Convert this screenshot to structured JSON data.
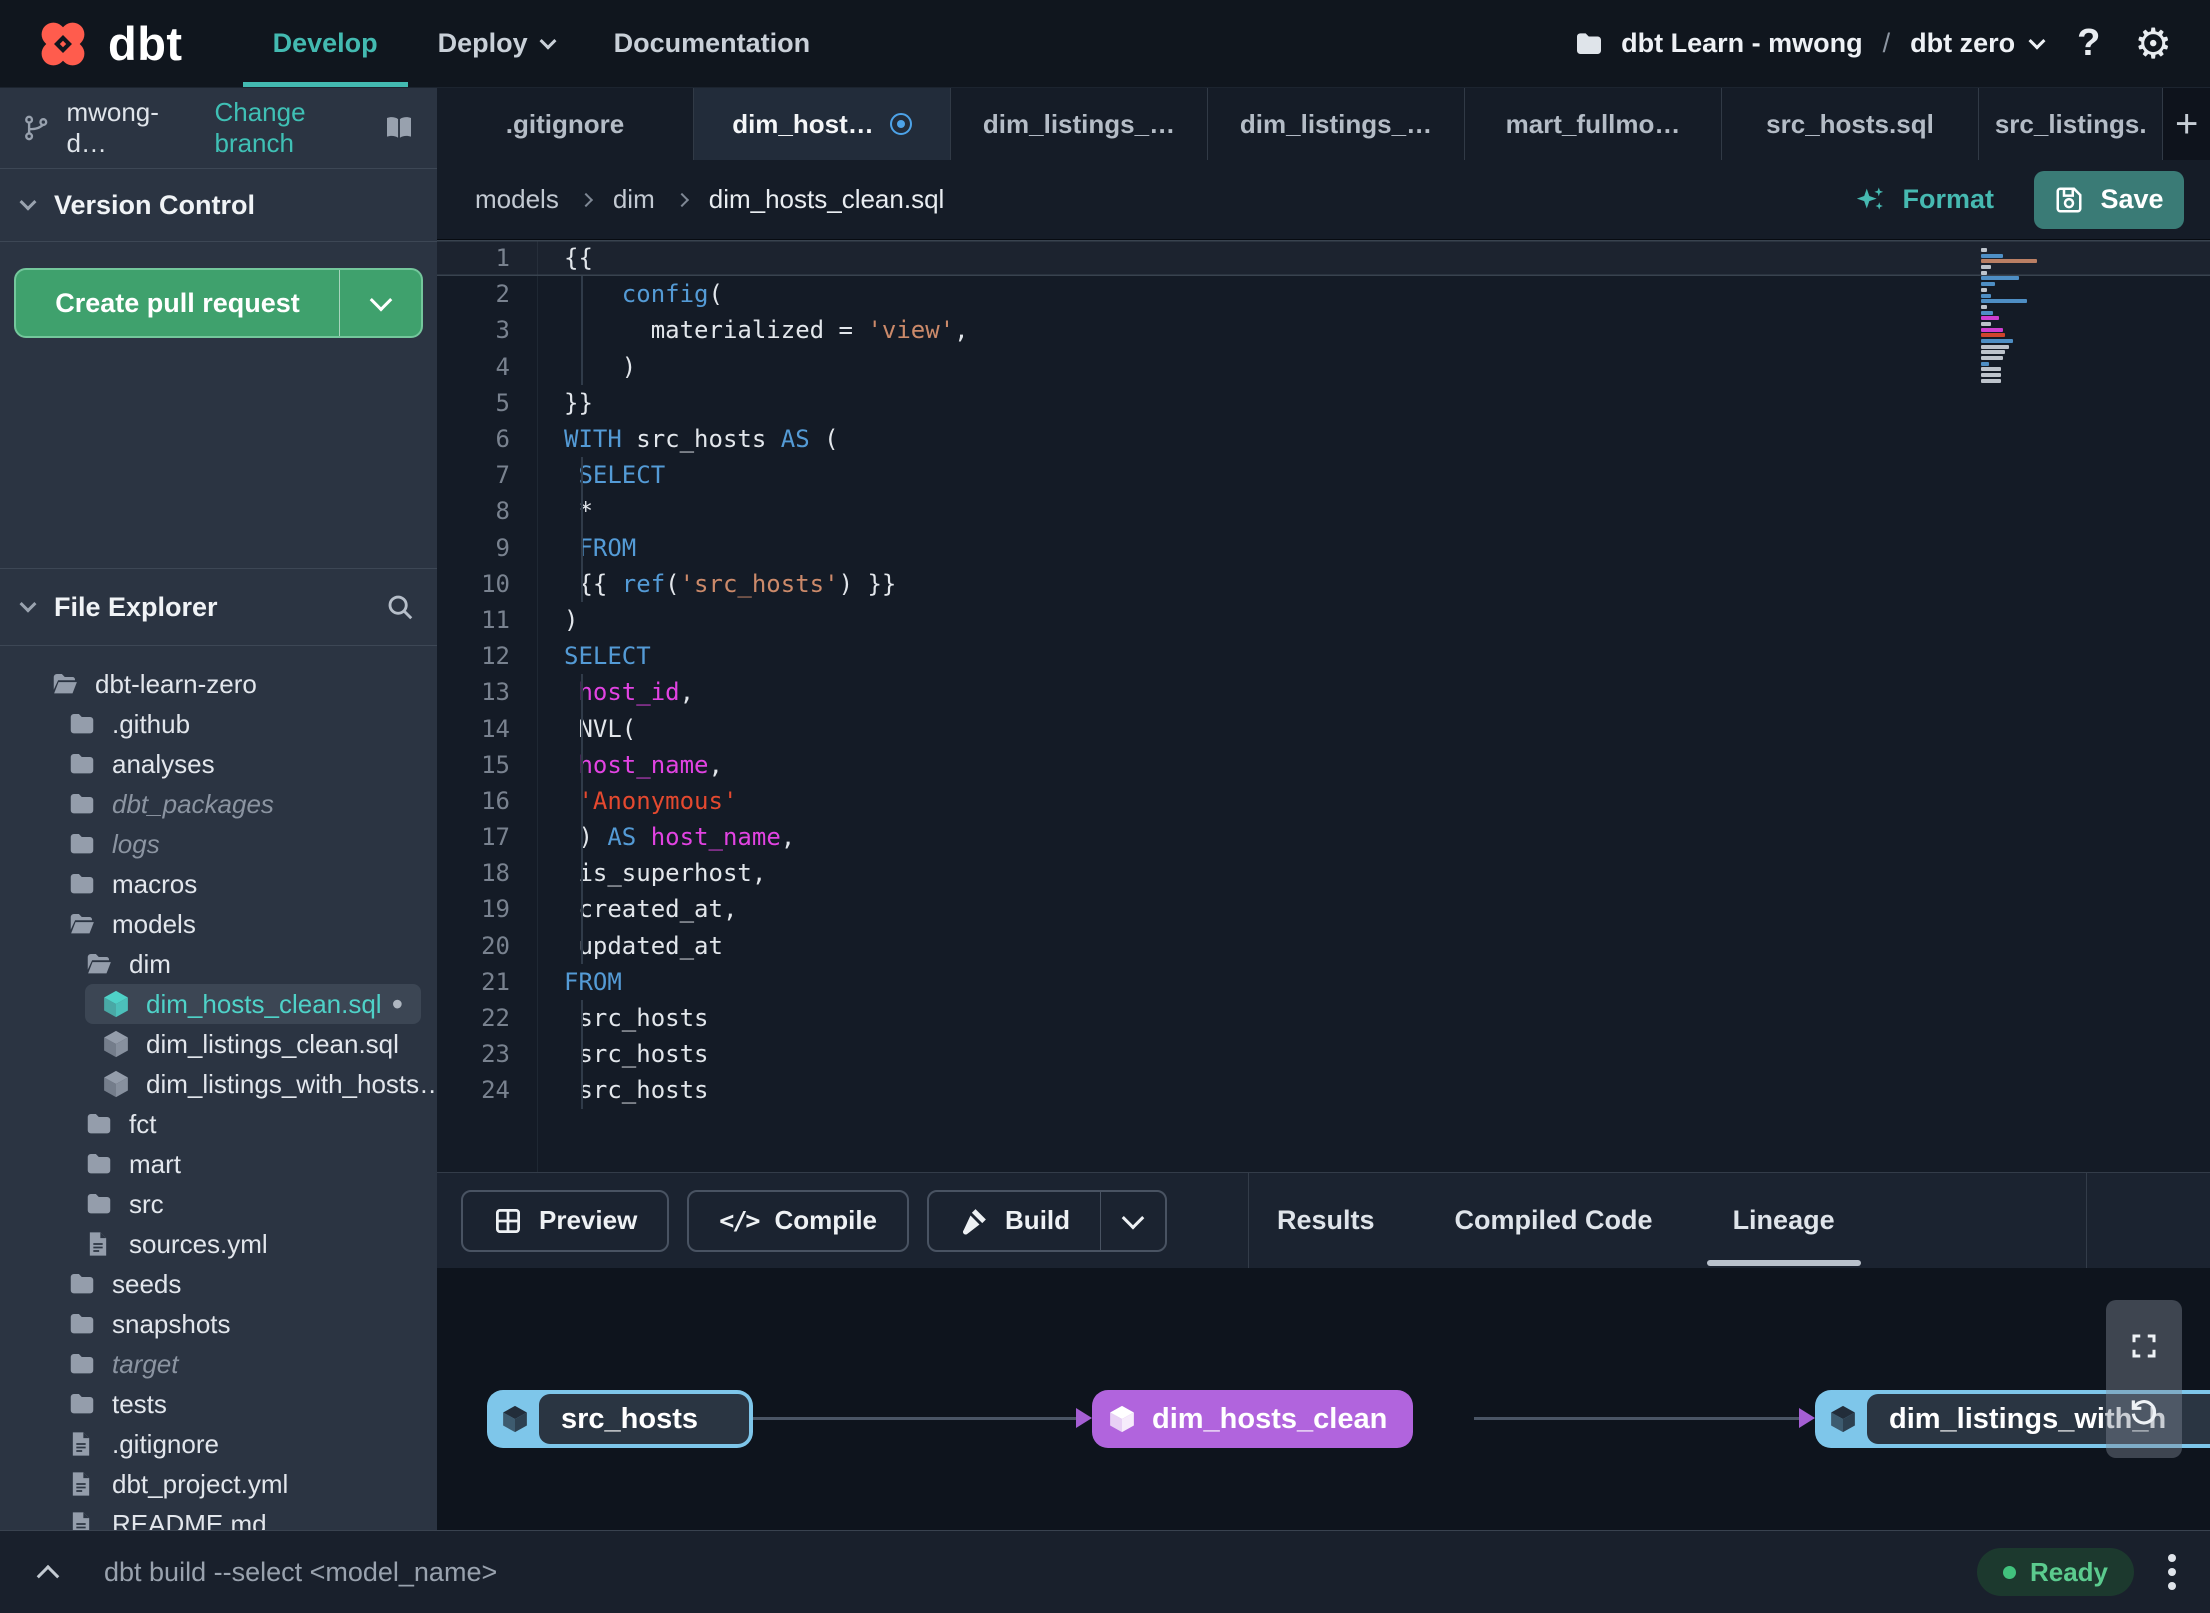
{
  "nav": {
    "brand": "dbt",
    "items": [
      {
        "label": "Develop",
        "active": true,
        "chevron": false
      },
      {
        "label": "Deploy",
        "active": false,
        "chevron": true
      },
      {
        "label": "Documentation",
        "active": false,
        "chevron": false
      }
    ],
    "project": {
      "name": "dbt Learn - mwong",
      "separator": "/",
      "env": "dbt zero"
    },
    "help_label": "?",
    "gear_glyph": "⚙"
  },
  "sidebar": {
    "branch": {
      "name": "mwong-d…",
      "change_label": "Change branch"
    },
    "version_control": {
      "title": "Version Control",
      "cta_label": "Create pull request"
    },
    "file_explorer": {
      "title": "File Explorer"
    },
    "tree": [
      {
        "label": "dbt-learn-zero",
        "icon": "folder-open",
        "level": 0
      },
      {
        "label": ".github",
        "icon": "folder",
        "level": 1
      },
      {
        "label": "analyses",
        "icon": "folder",
        "level": 1
      },
      {
        "label": "dbt_packages",
        "icon": "folder",
        "level": 1,
        "ghost": true
      },
      {
        "label": "logs",
        "icon": "folder",
        "level": 1,
        "ghost": true
      },
      {
        "label": "macros",
        "icon": "folder",
        "level": 1
      },
      {
        "label": "models",
        "icon": "folder-open",
        "level": 1
      },
      {
        "label": "dim",
        "icon": "folder-open",
        "level": 2
      },
      {
        "label": "dim_hosts_clean.sql",
        "icon": "cube",
        "level": 3,
        "selected": true,
        "modified": true
      },
      {
        "label": "dim_listings_clean.sql",
        "icon": "cube",
        "level": 3
      },
      {
        "label": "dim_listings_with_hosts…",
        "icon": "cube",
        "level": 3
      },
      {
        "label": "fct",
        "icon": "folder",
        "level": 2
      },
      {
        "label": "mart",
        "icon": "folder",
        "level": 2
      },
      {
        "label": "src",
        "icon": "folder",
        "level": 2
      },
      {
        "label": "sources.yml",
        "icon": "file",
        "level": 2
      },
      {
        "label": "seeds",
        "icon": "folder",
        "level": 1
      },
      {
        "label": "snapshots",
        "icon": "folder",
        "level": 1
      },
      {
        "label": "target",
        "icon": "folder",
        "level": 1,
        "ghost": true
      },
      {
        "label": "tests",
        "icon": "folder",
        "level": 1
      },
      {
        "label": ".gitignore",
        "icon": "file",
        "level": 1
      },
      {
        "label": "dbt_project.yml",
        "icon": "file",
        "level": 1
      },
      {
        "label": "README.md",
        "icon": "file",
        "level": 1
      }
    ],
    "modified_dot": "•"
  },
  "tabs": {
    "items": [
      {
        "label": ".gitignore"
      },
      {
        "label": "dim_host…",
        "active": true,
        "modified": true
      },
      {
        "label": "dim_listings_…"
      },
      {
        "label": "dim_listings_…"
      },
      {
        "label": "mart_fullmo…"
      },
      {
        "label": "src_hosts.sql"
      },
      {
        "label": "src_listings."
      }
    ],
    "new_tab_label": "+"
  },
  "editor": {
    "breadcrumb": [
      "models",
      "dim",
      "dim_hosts_clean.sql"
    ],
    "format_label": "Format",
    "save_label": "Save",
    "active_line": 1,
    "palette": {
      "kw": "#549bd6",
      "str": "#cc8a6a",
      "red": "#e4492f",
      "ident": "#e243e2",
      "plain": "#e2e6eb"
    },
    "lines": [
      [
        [
          "{{",
          "plain"
        ]
      ],
      [
        [
          "    ",
          "plain"
        ],
        [
          "config",
          "kw"
        ],
        [
          "(",
          "plain"
        ]
      ],
      [
        [
          "      ",
          "plain"
        ],
        [
          "materialized = ",
          "plain"
        ],
        [
          "'view'",
          "str"
        ],
        [
          ",",
          "plain"
        ]
      ],
      [
        [
          "    )",
          "plain"
        ]
      ],
      [
        [
          "}}",
          "plain"
        ]
      ],
      [
        [
          "WITH",
          "kw"
        ],
        [
          " src_hosts ",
          "plain"
        ],
        [
          "AS",
          "kw"
        ],
        [
          " (",
          "plain"
        ]
      ],
      [
        [
          " ",
          "plain"
        ],
        [
          "SELECT",
          "kw"
        ]
      ],
      [
        [
          " *",
          "plain"
        ]
      ],
      [
        [
          " ",
          "plain"
        ],
        [
          "FROM",
          "kw"
        ]
      ],
      [
        [
          " {{ ",
          "plain"
        ],
        [
          "ref",
          "kw"
        ],
        [
          "(",
          "plain"
        ],
        [
          "'src_hosts'",
          "str"
        ],
        [
          ") }}",
          "plain"
        ]
      ],
      [
        [
          ")",
          "plain"
        ]
      ],
      [
        [
          "SELECT",
          "kw"
        ]
      ],
      [
        [
          " ",
          "plain"
        ],
        [
          "host_id",
          "ident"
        ],
        [
          ",",
          "plain"
        ]
      ],
      [
        [
          " NVL(",
          "plain"
        ]
      ],
      [
        [
          " ",
          "plain"
        ],
        [
          "host_name",
          "ident"
        ],
        [
          ",",
          "plain"
        ]
      ],
      [
        [
          " ",
          "plain"
        ],
        [
          "'Anonymous'",
          "red"
        ]
      ],
      [
        [
          " ) ",
          "plain"
        ],
        [
          "AS",
          "kw"
        ],
        [
          " ",
          "plain"
        ],
        [
          "host_name",
          "ident"
        ],
        [
          ",",
          "plain"
        ]
      ],
      [
        [
          " is_superhost,",
          "plain"
        ]
      ],
      [
        [
          " created_at,",
          "plain"
        ]
      ],
      [
        [
          " updated_at",
          "plain"
        ]
      ],
      [
        [
          "FROM",
          "kw"
        ]
      ],
      [
        [
          " src_hosts",
          "plain"
        ]
      ],
      [
        [
          " src_hosts",
          "plain"
        ]
      ],
      [
        [
          " src_hosts",
          "plain"
        ]
      ]
    ]
  },
  "bottom_panel": {
    "actions": [
      {
        "label": "Preview",
        "icon": "grid"
      },
      {
        "label": "Compile",
        "icon": "code"
      },
      {
        "label": "Build",
        "icon": "hammer",
        "split": true
      }
    ],
    "compile_glyph": "</>",
    "tabs": [
      {
        "label": "Results"
      },
      {
        "label": "Compiled Code"
      },
      {
        "label": "Lineage",
        "active": true
      }
    ]
  },
  "lineage": {
    "nodes": [
      {
        "label": "src_hosts",
        "variant": "source"
      },
      {
        "label": "dim_hosts_clean",
        "variant": "model"
      },
      {
        "label": "dim_listings_with_h",
        "variant": "source"
      }
    ],
    "colors": {
      "source_blue": "#7ec6ea",
      "model_purple": "#b164dd",
      "edge": "#4a5565",
      "arrow": "#a55fd4"
    }
  },
  "statusbar": {
    "command": "dbt build --select <model_name>",
    "status_label": "Ready",
    "status_color": "#41c27d"
  },
  "theme": {
    "accent_teal": "#43bab1",
    "cta_green": "#3fa16d",
    "save_teal": "#3a7b76",
    "modified_blue": "#4da3e8"
  }
}
